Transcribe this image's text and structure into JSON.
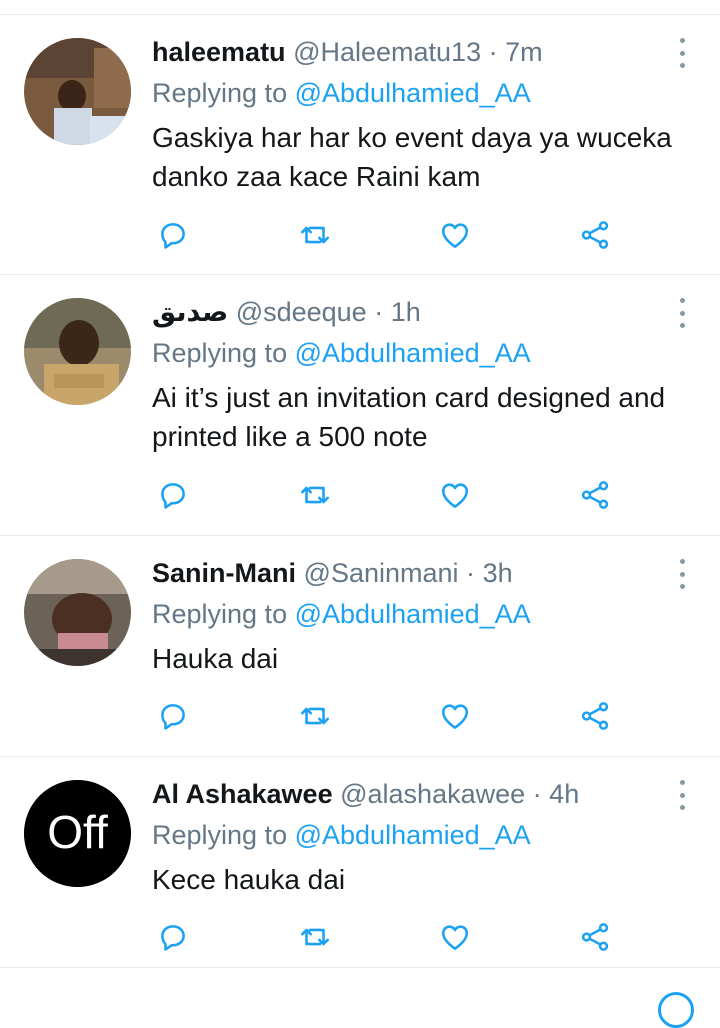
{
  "reply_prefix": "Replying to",
  "separator": "·",
  "colors": {
    "link": "#1da1f2",
    "secondary": "#657786",
    "icon": "#1da1f2"
  },
  "tweets": [
    {
      "name": "haleematu",
      "handle": "@Haleematu13",
      "time": "7m",
      "replying_to": "@Abdulhamied_AA",
      "text": "Gaskiya har har ko event daya ya wuceka danko zaa kace Raini kam"
    },
    {
      "name": "صدىق",
      "handle": "@sdeeque",
      "time": "1h",
      "replying_to": "@Abdulhamied_AA",
      "text": "Ai it’s just an invitation card designed and printed like a 500 note"
    },
    {
      "name": "Sanin-Mani",
      "handle": "@Saninmani",
      "time": "3h",
      "replying_to": "@Abdulhamied_AA",
      "text": "Hauka dai"
    },
    {
      "name": "Al Ashakawee",
      "handle": "@alashakawee",
      "time": "4h",
      "replying_to": "@Abdulhamied_AA",
      "text": "Kece hauka dai",
      "avatar_logo": "Off"
    }
  ],
  "icons": [
    "reply-icon",
    "retweet-icon",
    "like-icon",
    "share-icon",
    "more-options-icon"
  ]
}
